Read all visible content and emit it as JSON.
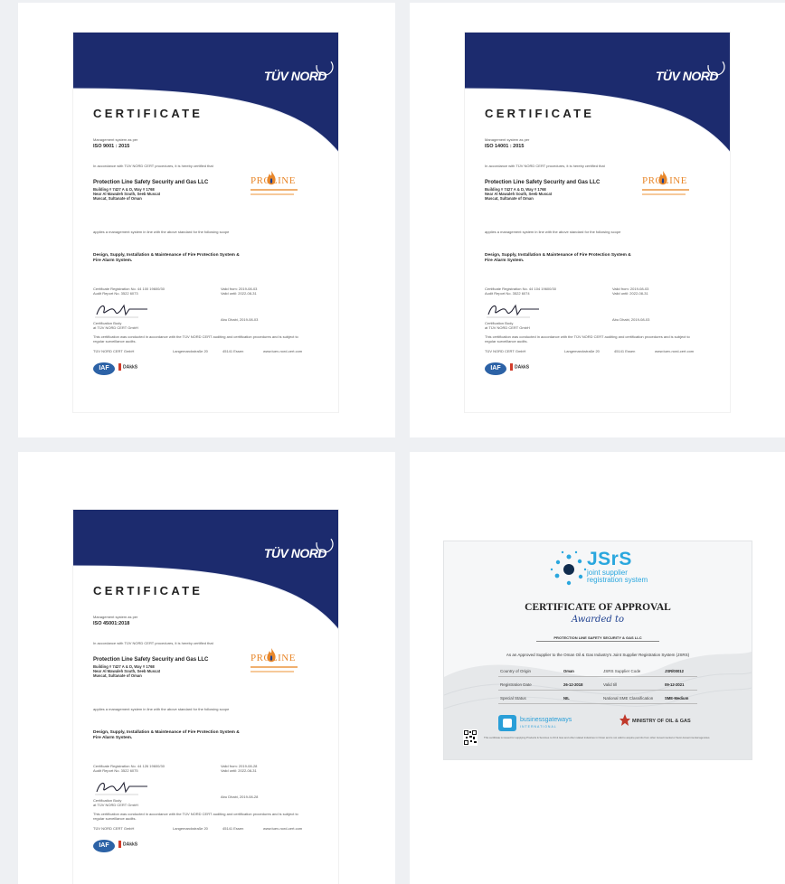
{
  "certificates": [
    {
      "brand": "TÜV NORD",
      "title": "CERTIFICATE",
      "standard_label": "Management system as per",
      "standard": "ISO 9001 : 2015",
      "accordance": "In accordance with TÜV NORD CERT procedures, it is hereby certified that",
      "company": "Protection Line Safety Security and Gas LLC",
      "address": [
        "Building # 7427 A & D, Way # 1768",
        "Near Al Mawaleh South, Seeb Muscat",
        "Muscat, Sultanate of Oman"
      ],
      "logo_text": "PROLINE",
      "applies": "applies a management system in line with the above standard for the following scope",
      "scope": [
        "Design, Supply, Installation & Maintenance of Fire Protection System &",
        "Fire Alarm System."
      ],
      "registration": [
        "Certificate Registration No. 44 100 19600/30",
        "Audit Report No. 3522 6073"
      ],
      "validity": [
        "Valid from: 2019-08-03",
        "Valid until: 2022-08-31"
      ],
      "cert_body": [
        "Certification Body",
        "at TÜV NORD CERT GmbH"
      ],
      "date": "Abu Dhabi, 2019-08-03",
      "note": [
        "This certification was conducted in accordance with the TÜV NORD CERT auditing and certification procedures and is subject to",
        "regular surveillance audits."
      ],
      "footer_address": [
        "TÜV NORD CERT GmbH",
        "Langemarckstraße 20",
        "45141 Essen",
        "www.tuev-nord-cert.com"
      ],
      "iaf": "IAF",
      "dakks": "DAkkS"
    },
    {
      "brand": "TÜV NORD",
      "title": "CERTIFICATE",
      "standard_label": "Management system as per",
      "standard": "ISO 14001 : 2015",
      "accordance": "In accordance with TÜV NORD CERT procedures, it is hereby certified that",
      "company": "Protection Line Safety Security and Gas LLC",
      "address": [
        "Building # 7427 A & D, Way # 1768",
        "Near Al Mawaleh South, Seeb Muscat",
        "Muscat, Sultanate of Oman"
      ],
      "logo_text": "PROLINE",
      "applies": "applies a management system in line with the above standard for the following scope",
      "scope": [
        "Design, Supply, Installation & Maintenance of Fire Protection System &",
        "Fire Alarm System."
      ],
      "registration": [
        "Certificate Registration No. 44 104 19600/30",
        "Audit Report No. 3522 6074"
      ],
      "validity": [
        "Valid from: 2019-08-03",
        "Valid until: 2022-08-31"
      ],
      "cert_body": [
        "Certification Body",
        "at TÜV NORD CERT GmbH"
      ],
      "date": "Abu Dhabi, 2019-08-03",
      "note": [
        "This certification was conducted in accordance with the TÜV NORD CERT auditing and certification procedures and is subject to",
        "regular surveillance audits."
      ],
      "footer_address": [
        "TÜV NORD CERT GmbH",
        "Langemarckstraße 20",
        "45141 Essen",
        "www.tuev-nord-cert.com"
      ],
      "iaf": "IAF",
      "dakks": "DAkkS"
    },
    {
      "brand": "TÜV NORD",
      "title": "CERTIFICATE",
      "standard_label": "Management system as per",
      "standard": "ISO 45001:2018",
      "accordance": "In accordance with TÜV NORD CERT procedures, it is hereby certified that",
      "company": "Protection Line Safety Security and Gas LLC",
      "address": [
        "Building # 7427 A & D, Way # 1768",
        "Near Al Mawaleh South, Seeb Muscat",
        "Muscat, Sultanate of Oman"
      ],
      "logo_text": "PROLINE",
      "applies": "applies a management system in line with the above standard for the following scope",
      "scope": [
        "Design, Supply, Installation & Maintenance of Fire Protection System &",
        "Fire Alarm System."
      ],
      "registration": [
        "Certificate Registration No. 44 126 19600/30",
        "Audit Report No. 3522 6075"
      ],
      "validity": [
        "Valid from: 2019-08-28",
        "Valid until: 2022-08-31"
      ],
      "cert_body": [
        "Certification Body",
        "at TÜV NORD CERT GmbH"
      ],
      "date": "Abu Dhabi, 2019-08-28",
      "note": [
        "This certification was conducted in accordance with the TÜV NORD CERT auditing and certification procedures and is subject to",
        "regular surveillance audits."
      ],
      "footer_address": [
        "TÜV NORD CERT GmbH",
        "Langemarckstraße 20",
        "45141 Essen",
        "www.tuev-nord-cert.com"
      ],
      "iaf": "IAF",
      "dakks": "DAkkS"
    }
  ],
  "jsrs": {
    "logo": "JSrS",
    "sub1": "joint supplier",
    "sub2": "registration system",
    "title": "CERTIFICATE OF APPROVAL",
    "awarded": "Awarded to",
    "company": "PROTECTION LINE SAFETY SECURITY & GAS LLC",
    "approved": "As an Approved Supplier to the Oman Oil & Gas Industry's Joint Supplier Registration System (JSRS)",
    "rows": [
      {
        "l1": "Country of Origin",
        "v1": "Oman",
        "l2": "JSRS Supplier Code",
        "v2": "JSR/00012"
      },
      {
        "l1": "Registration Date",
        "v1": "26-12-2018",
        "l2": "Valid till",
        "v2": "09-12-2021"
      },
      {
        "l1": "Special Status",
        "v1": "NIL",
        "l2": "National SME Classification",
        "v2": "SME-Medium"
      }
    ],
    "partner1": "businessgateways",
    "partner1_sub": "INTERNATIONAL",
    "partner2": "MINISTRY OF OIL & GAS",
    "footer": "This certificate is issued for supplying Products & Services to Oil & Gas and other related industries in Oman and is not valid to acquire permits from other Governmental or Semi-Governmental agencies."
  }
}
